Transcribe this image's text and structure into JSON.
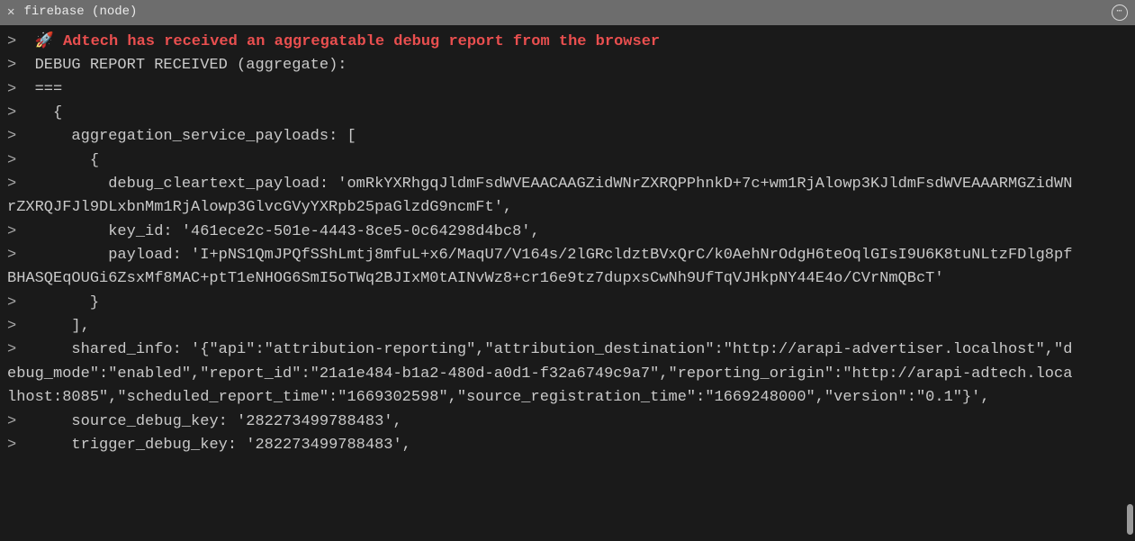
{
  "header": {
    "title": "firebase (node)",
    "close": "✕",
    "more": "⋯"
  },
  "console": {
    "prompt": ">",
    "rocket": "🚀",
    "highlight": "Adtech has received an aggregatable debug report from the browser",
    "lines": [
      "DEBUG REPORT RECEIVED (aggregate):",
      "===",
      "  {",
      "    aggregation_service_payloads: [",
      "      {",
      "        debug_cleartext_payload: 'omRkYXRhgqJldmFsdWVEAACAAGZidWNrZXRQPPhnkD+7c+wm1RjAlowp3KJldmFsdWVEAAARMGZidWNrZXRQJFJl9DLxbnMm1RjAlowp3GlvcGVyYXRpb25paGlzdG9ncmFt',",
      "        key_id: '461ece2c-501e-4443-8ce5-0c64298d4bc8',",
      "        payload: 'I+pNS1QmJPQfSShLmtj8mfuL+x6/MaqU7/V164s/2lGRcldztBVxQrC/k0AehNrOdgH6teOqlGIsI9U6K8tuNLtzFDlg8pfBHASQEqOUGi6ZsxMf8MAC+ptT1eNHOG6SmI5oTWq2BJIxM0tAINvWz8+cr16e9tz7dupxsCwNh9UfTqVJHkpNY44E4o/CVrNmQBcT'",
      "      }",
      "    ],",
      "    shared_info: '{\"api\":\"attribution-reporting\",\"attribution_destination\":\"http://arapi-advertiser.localhost\",\"debug_mode\":\"enabled\",\"report_id\":\"21a1e484-b1a2-480d-a0d1-f32a6749c9a7\",\"reporting_origin\":\"http://arapi-adtech.localhost:8085\",\"scheduled_report_time\":\"1669302598\",\"source_registration_time\":\"1669248000\",\"version\":\"0.1\"}',",
      "    source_debug_key: '282273499788483',",
      "    trigger_debug_key: '282273499788483',"
    ]
  }
}
